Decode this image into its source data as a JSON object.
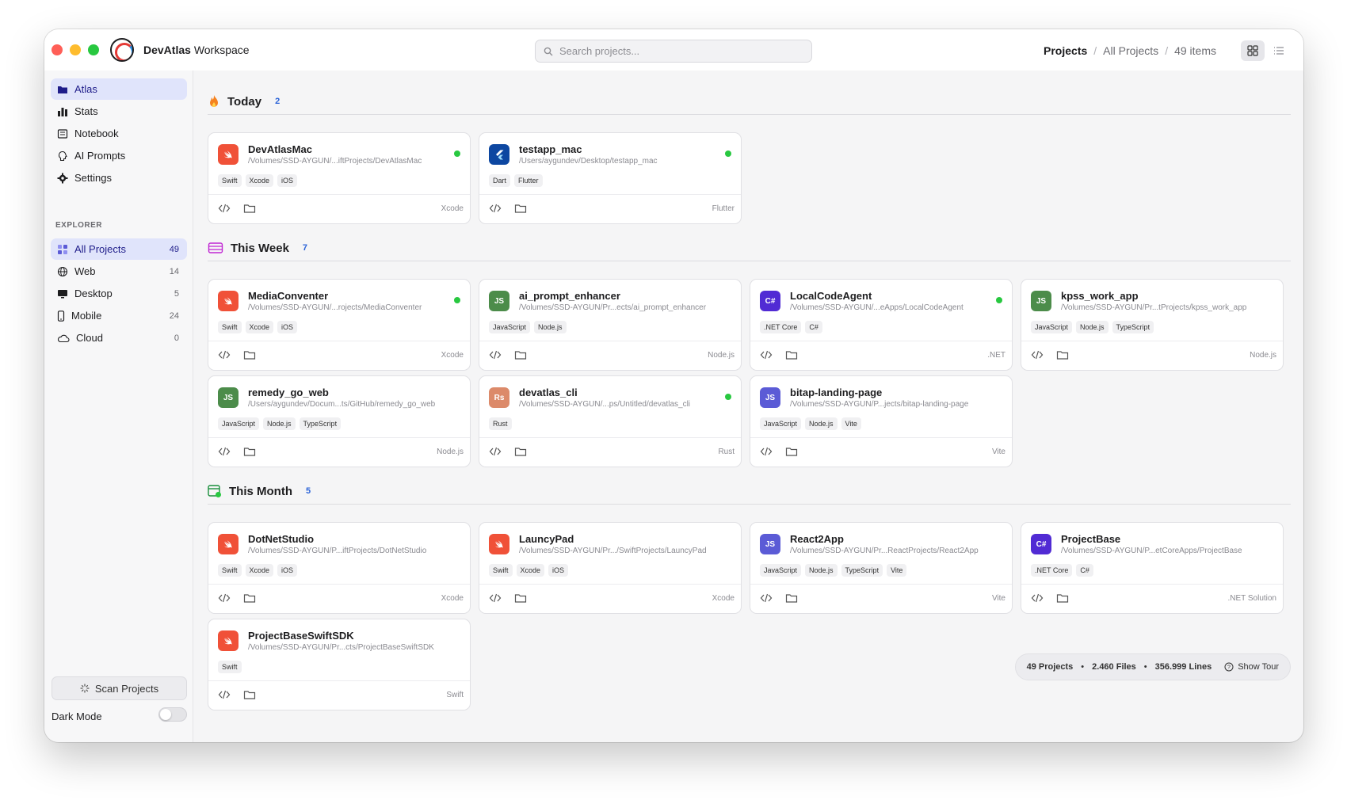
{
  "app": {
    "brand": "DevAtlas",
    "title_suffix": "Workspace"
  },
  "search": {
    "placeholder": "Search projects..."
  },
  "breadcrumb": {
    "current": "Projects",
    "section": "All Projects",
    "count": "49 items"
  },
  "sidebar": {
    "items": [
      {
        "label": "Atlas",
        "icon": "folder-icon"
      },
      {
        "label": "Stats",
        "icon": "bar-chart-icon"
      },
      {
        "label": "Notebook",
        "icon": "notebook-icon"
      },
      {
        "label": "AI Prompts",
        "icon": "brain-icon"
      },
      {
        "label": "Settings",
        "icon": "gear-icon"
      }
    ],
    "explorer_label": "EXPLORER",
    "explorer": [
      {
        "label": "All Projects",
        "count": "49"
      },
      {
        "label": "Web",
        "count": "14"
      },
      {
        "label": "Desktop",
        "count": "5"
      },
      {
        "label": "Mobile",
        "count": "24"
      },
      {
        "label": "Cloud",
        "count": "0"
      }
    ],
    "scan_label": "Scan Projects",
    "dark_mode_label": "Dark Mode"
  },
  "sections": [
    {
      "title": "Today",
      "count": "2",
      "cards": [
        {
          "name": "DevAtlasMac",
          "path": "/Volumes/SSD-AYGUN/...iftProjects/DevAtlasMac",
          "tags": [
            "Swift",
            "Xcode",
            "iOS"
          ],
          "ide": "Xcode",
          "icon": "swift",
          "active": true
        },
        {
          "name": "testapp_mac",
          "path": "/Users/aygundev/Desktop/testapp_mac",
          "tags": [
            "Dart",
            "Flutter"
          ],
          "ide": "Flutter",
          "icon": "flutter",
          "active": true
        }
      ]
    },
    {
      "title": "This Week",
      "count": "7",
      "cards": [
        {
          "name": "MediaConventer",
          "path": "/Volumes/SSD-AYGUN/...rojects/MediaConventer",
          "tags": [
            "Swift",
            "Xcode",
            "iOS"
          ],
          "ide": "Xcode",
          "icon": "swift",
          "active": true
        },
        {
          "name": "ai_prompt_enhancer",
          "path": "/Volumes/SSD-AYGUN/Pr...ects/ai_prompt_enhancer",
          "tags": [
            "JavaScript",
            "Node.js"
          ],
          "ide": "Node.js",
          "icon": "js-green",
          "active": false
        },
        {
          "name": "LocalCodeAgent",
          "path": "/Volumes/SSD-AYGUN/...eApps/LocalCodeAgent",
          "tags": [
            ".NET Core",
            "C#"
          ],
          "ide": ".NET",
          "icon": "csharp",
          "active": true
        },
        {
          "name": "kpss_work_app",
          "path": "/Volumes/SSD-AYGUN/Pr...tProjects/kpss_work_app",
          "tags": [
            "JavaScript",
            "Node.js",
            "TypeScript"
          ],
          "ide": "Node.js",
          "icon": "js-green",
          "active": false
        },
        {
          "name": "remedy_go_web",
          "path": "/Users/aygundev/Docum...ts/GitHub/remedy_go_web",
          "tags": [
            "JavaScript",
            "Node.js",
            "TypeScript"
          ],
          "ide": "Node.js",
          "icon": "js-green",
          "active": false
        },
        {
          "name": "devatlas_cli",
          "path": "/Volumes/SSD-AYGUN/...ps/Untitled/devatlas_cli",
          "tags": [
            "Rust"
          ],
          "ide": "Rust",
          "icon": "rust",
          "active": true
        },
        {
          "name": "bitap-landing-page",
          "path": "/Volumes/SSD-AYGUN/P...jects/bitap-landing-page",
          "tags": [
            "JavaScript",
            "Node.js",
            "Vite"
          ],
          "ide": "Vite",
          "icon": "js-blue",
          "active": false
        }
      ]
    },
    {
      "title": "This Month",
      "count": "5",
      "cards": [
        {
          "name": "DotNetStudio",
          "path": "/Volumes/SSD-AYGUN/P...iftProjects/DotNetStudio",
          "tags": [
            "Swift",
            "Xcode",
            "iOS"
          ],
          "ide": "Xcode",
          "icon": "swift",
          "active": false
        },
        {
          "name": "LauncyPad",
          "path": "/Volumes/SSD-AYGUN/Pr.../SwiftProjects/LauncyPad",
          "tags": [
            "Swift",
            "Xcode",
            "iOS"
          ],
          "ide": "Xcode",
          "icon": "swift",
          "active": false
        },
        {
          "name": "React2App",
          "path": "/Volumes/SSD-AYGUN/Pr...ReactProjects/React2App",
          "tags": [
            "JavaScript",
            "Node.js",
            "TypeScript",
            "Vite"
          ],
          "ide": "Vite",
          "icon": "js-blue",
          "active": false
        },
        {
          "name": "ProjectBase",
          "path": "/Volumes/SSD-AYGUN/P...etCoreApps/ProjectBase",
          "tags": [
            ".NET Core",
            "C#"
          ],
          "ide": ".NET Solution",
          "icon": "csharp",
          "active": false
        },
        {
          "name": "ProjectBaseSwiftSDK",
          "path": "/Volumes/SSD-AYGUN/Pr...cts/ProjectBaseSwiftSDK",
          "tags": [
            "Swift"
          ],
          "ide": "Swift",
          "icon": "swift",
          "active": false
        }
      ]
    }
  ],
  "icon_labels": {
    "js-green": "JS",
    "js-blue": "JS",
    "csharp": "C#",
    "rust": "Rs"
  },
  "icon_colors": {
    "swift": "#f05138",
    "flutter": "#0d47a1",
    "js-green": "#4c8c4a",
    "js-blue": "#5b5bd6",
    "csharp": "#512bd4",
    "rust": "#dc8a6a"
  },
  "footer": {
    "projects": "49 Projects",
    "files": "2.460 Files",
    "lines": "356.999 Lines",
    "tour": "Show Tour"
  }
}
